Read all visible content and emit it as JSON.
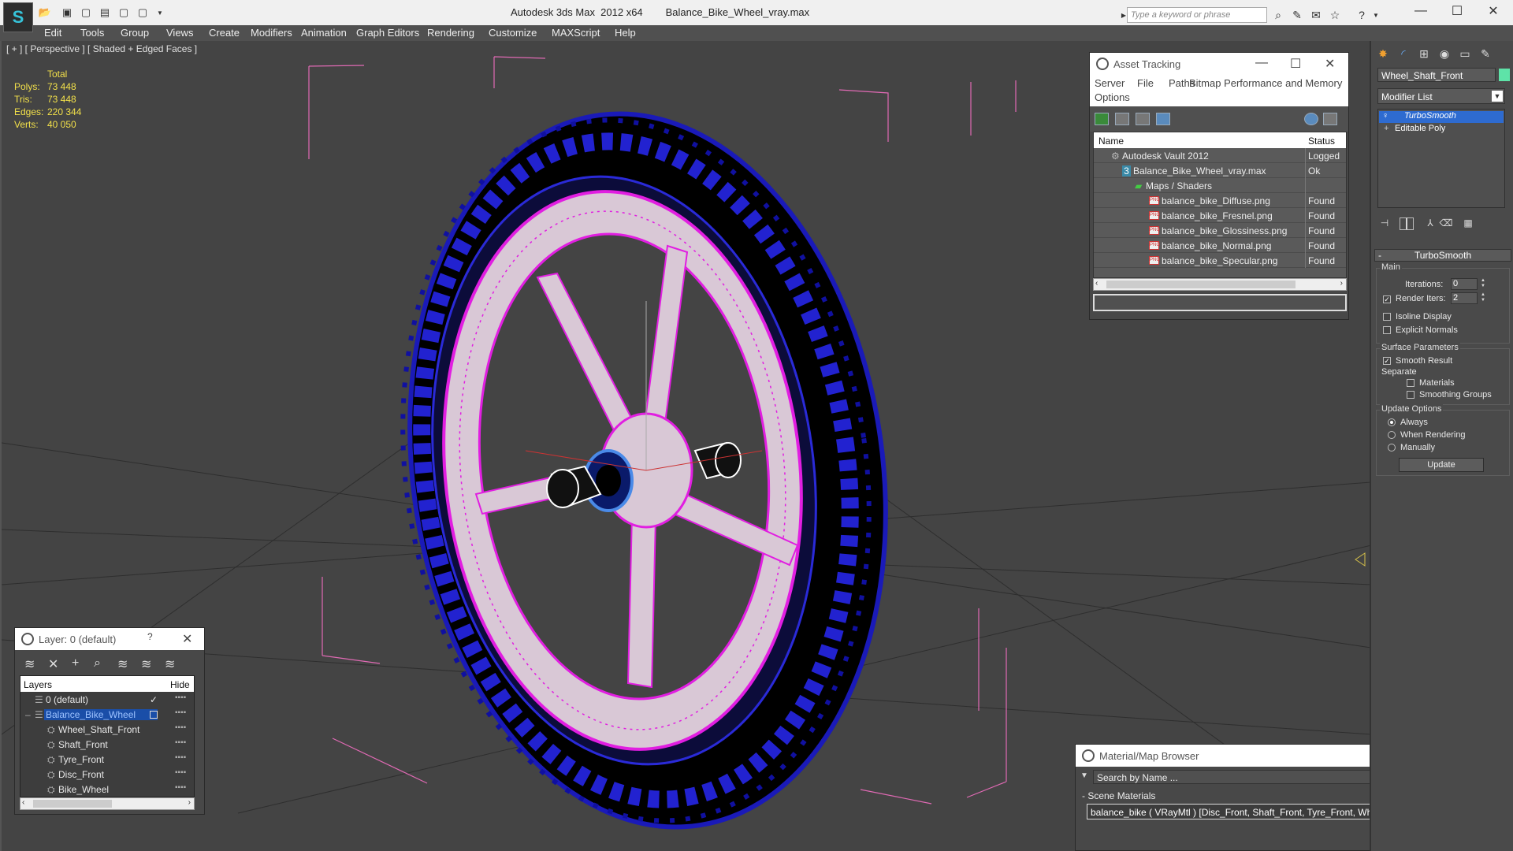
{
  "app": {
    "title": "Autodesk 3ds Max  2012 x64",
    "file": "Balance_Bike_Wheel_vray.max",
    "search_placeholder": "Type a keyword or phrase"
  },
  "menu": [
    "Edit",
    "Tools",
    "Group",
    "Views",
    "Create",
    "Modifiers",
    "Animation",
    "Graph Editors",
    "Rendering",
    "Customize",
    "MAXScript",
    "Help"
  ],
  "viewport": {
    "label": "[ + ] [ Perspective ] [ Shaded + Edged Faces ]",
    "stats": {
      "header": "Total",
      "rows": [
        {
          "label": "Polys:",
          "value": "73 448"
        },
        {
          "label": "Tris:",
          "value": "73 448"
        },
        {
          "label": "Edges:",
          "value": "220 344"
        },
        {
          "label": "Verts:",
          "value": "40 050"
        }
      ]
    }
  },
  "asset_tracking": {
    "title": "Asset Tracking",
    "menu": [
      "Server",
      "File",
      "Paths",
      "Bitmap Performance and Memory",
      "Options"
    ],
    "columns": [
      "Name",
      "Status"
    ],
    "rows": [
      {
        "name": "Autodesk Vault 2012",
        "status": "Logged"
      },
      {
        "name": "Balance_Bike_Wheel_vray.max",
        "status": "Ok"
      },
      {
        "name": "Maps / Shaders",
        "status": ""
      },
      {
        "name": "balance_bike_Diffuse.png",
        "status": "Found"
      },
      {
        "name": "balance_bike_Fresnel.png",
        "status": "Found"
      },
      {
        "name": "balance_bike_Glossiness.png",
        "status": "Found"
      },
      {
        "name": "balance_bike_Normal.png",
        "status": "Found"
      },
      {
        "name": "balance_bike_Specular.png",
        "status": "Found"
      }
    ]
  },
  "layers": {
    "title": "Layer: 0 (default)",
    "help": "?",
    "columns": [
      "Layers",
      "Hide"
    ],
    "rows": [
      {
        "name": "0 (default)"
      },
      {
        "name": "Balance_Bike_Wheel"
      },
      {
        "name": "Wheel_Shaft_Front"
      },
      {
        "name": "Shaft_Front"
      },
      {
        "name": "Tyre_Front"
      },
      {
        "name": "Disc_Front"
      },
      {
        "name": "Bike_Wheel"
      }
    ]
  },
  "material_browser": {
    "title": "Material/Map Browser",
    "search_placeholder": "Search by Name ...",
    "section": "- Scene Materials",
    "item": "balance_bike  ( VRayMtl )  [Disc_Front, Shaft_Front, Tyre_Front, Wheel_Shaft_Front]"
  },
  "command_panel": {
    "object_name": "Wheel_Shaft_Front",
    "object_color": "#5ee3a8",
    "modifier_list": "Modifier List",
    "stack": [
      "TurboSmooth",
      "Editable Poly"
    ],
    "rollout_title": "TurboSmooth",
    "main_group": "Main",
    "iterations_label": "Iterations:",
    "iterations_value": "0",
    "render_iters_label": "Render Iters:",
    "render_iters_value": "2",
    "render_iters_checked": true,
    "isoline_label": "Isoline Display",
    "explicit_normals_label": "Explicit Normals",
    "surface_group": "Surface Parameters",
    "smooth_result_label": "Smooth Result",
    "separate_label": "Separate",
    "materials_label": "Materials",
    "smoothing_groups_label": "Smoothing Groups",
    "update_group": "Update Options",
    "always_label": "Always",
    "when_rendering_label": "When Rendering",
    "manually_label": "Manually",
    "update_button": "Update"
  },
  "colors": {
    "wire_tyre": "#1a1ab8",
    "wire_rim": "#e11ee1",
    "accent_selection": "#2e6bd0"
  }
}
